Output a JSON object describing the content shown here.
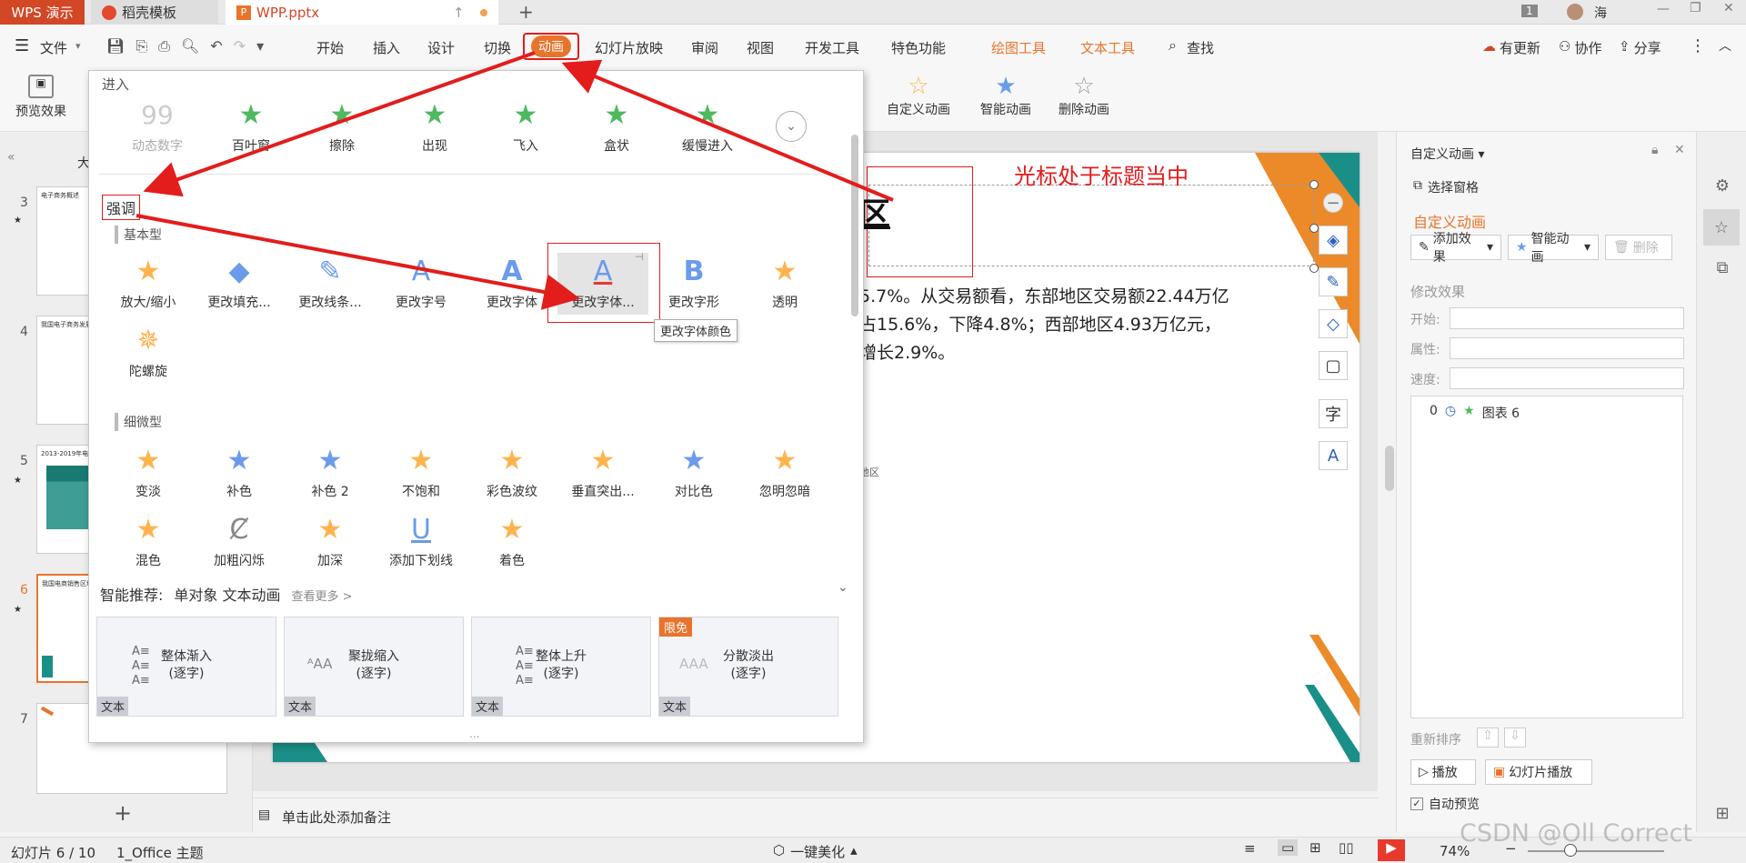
{
  "titlebar": {
    "tabs": [
      {
        "label": "WPS 演示"
      },
      {
        "label": "稻壳模板"
      },
      {
        "label": "WPP.pptx"
      }
    ],
    "badge": "1",
    "user": "海"
  },
  "menu": {
    "file": "文件",
    "items": [
      "开始",
      "插入",
      "设计",
      "切换",
      "动画",
      "幻灯片放映",
      "审阅",
      "视图",
      "开发工具",
      "特色功能"
    ],
    "context": [
      "绘图工具",
      "文本工具"
    ],
    "search": "查找",
    "right": [
      "有更新",
      "协作",
      "分享"
    ]
  },
  "toolbar": {
    "preview": "预览效果",
    "custom_anim": "自定义动画",
    "smart_anim": "智能动画",
    "delete_anim": "删除动画"
  },
  "dropdown": {
    "enter_title": "进入",
    "enter_effects": [
      "动态数字",
      "百叶窗",
      "擦除",
      "出现",
      "飞入",
      "盒状",
      "缓慢进入"
    ],
    "emphasis_title": "强调",
    "basic_title": "基本型",
    "basic_effects": [
      "放大/缩小",
      "更改填充...",
      "更改线条...",
      "更改字号",
      "更改字体",
      "更改字体...",
      "更改字形",
      "透明",
      "陀螺旋"
    ],
    "tooltip": "更改字体颜色",
    "subtle_title": "细微型",
    "subtle_effects": [
      "变淡",
      "补色",
      "补色 2",
      "不饱和",
      "彩色波纹",
      "垂直突出...",
      "对比色",
      "忽明忽暗",
      "混色",
      "加粗闪烁",
      "加深",
      "添加下划线",
      "着色"
    ],
    "smart_title": "智能推荐:",
    "smart_subtitle": "单对象 文本动画",
    "smart_more": "查看更多 >",
    "smart_items": [
      {
        "label": "整体渐入\n(逐字)",
        "tag": "文本"
      },
      {
        "label": "聚拢缩入\n(逐字)",
        "tag": "文本"
      },
      {
        "label": "整体上升\n(逐字)",
        "tag": "文本"
      },
      {
        "label": "分散淡出\n(逐字)",
        "tag": "文本",
        "badge": "限免"
      }
    ],
    "ellipsis": "..."
  },
  "slide": {
    "annotation": "光标处于标题当中",
    "title_fragment": "区",
    "body_lines": [
      "5.7%。从交易额看，东部地区交易额22.44万亿",
      "占15.6%，下降4.8%；西部地区4.93万亿元，",
      "增长2.9%。"
    ],
    "chart_label": "地区"
  },
  "thumbs": [
    {
      "num": "3",
      "title": "电子商务概述"
    },
    {
      "num": "4",
      "title": "我国电子商务发展"
    },
    {
      "num": "5",
      "title": "2013-2019年电子商务交易额"
    },
    {
      "num": "6",
      "title": "我国电商销售区域"
    },
    {
      "num": "7",
      "title": ""
    }
  ],
  "thumb_header": "大",
  "notes": "单击此处添加备注",
  "rpanel": {
    "title": "自定义动画",
    "select_pane": "选择窗格",
    "section": "自定义动画",
    "add_effect": "添加效果",
    "smart_anim": "智能动画",
    "delete": "删除",
    "modify": "修改效果",
    "start": "开始:",
    "property": "属性:",
    "speed": "速度:",
    "list_item": "图表 6",
    "list_index": "0",
    "reorder": "重新排序",
    "play": "播放",
    "slideshow": "幻灯片播放",
    "auto_preview": "自动预览"
  },
  "status": {
    "slide_info": "幻灯片 6 / 10",
    "theme": "1_Office 主题",
    "beautify": "一键美化",
    "zoom": "74%",
    "watermark": "CSDN @Oll Correct"
  },
  "colors": {
    "accent": "#d24726",
    "highlight": "#e31c1c",
    "tool_orange": "#e8742c"
  }
}
